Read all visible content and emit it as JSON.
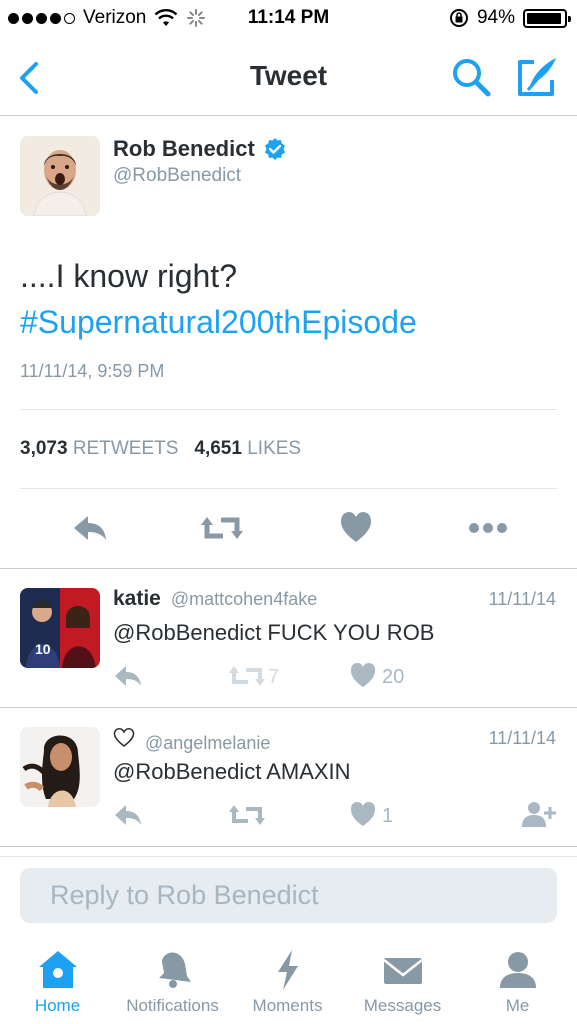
{
  "status_bar": {
    "carrier": "Verizon",
    "time": "11:14 PM",
    "battery": "94%",
    "battery_level": 0.94
  },
  "nav": {
    "title": "Tweet",
    "icons": [
      "back-chevron-icon",
      "search-icon",
      "compose-tweet-icon"
    ]
  },
  "tweet": {
    "author_name": "Rob Benedict",
    "author_handle": "@RobBenedict",
    "verified": true,
    "text": "....I know right?",
    "hashtag": "#Supernatural200thEpisode",
    "timestamp": "11/11/14, 9:59 PM",
    "retweets_count": "3,073",
    "retweets_label": "RETWEETS",
    "likes_count": "4,651",
    "likes_label": "LIKES"
  },
  "replies": [
    {
      "name": "katie",
      "handle": "@mattcohen4fake",
      "date": "11/11/14",
      "text": "@RobBenedict FUCK YOU ROB",
      "retweets": "7",
      "likes": "20"
    },
    {
      "name_icon": "heart-outline-icon",
      "handle": "@angelmelanie",
      "date": "11/11/14",
      "text": "@RobBenedict AMAXIN",
      "likes": "1"
    }
  ],
  "reply_box": {
    "placeholder": "Reply to Rob Benedict"
  },
  "tabs": [
    {
      "label": "Home",
      "icon": "home-icon",
      "active": true
    },
    {
      "label": "Notifications",
      "icon": "bell-icon",
      "active": false
    },
    {
      "label": "Moments",
      "icon": "lightning-icon",
      "active": false
    },
    {
      "label": "Messages",
      "icon": "envelope-icon",
      "active": false
    },
    {
      "label": "Me",
      "icon": "person-icon",
      "active": false
    }
  ],
  "colors": {
    "accent": "#1da1f2",
    "text": "#292f33",
    "secondary": "#8899a6",
    "icon_gray": "#aab8c2"
  }
}
